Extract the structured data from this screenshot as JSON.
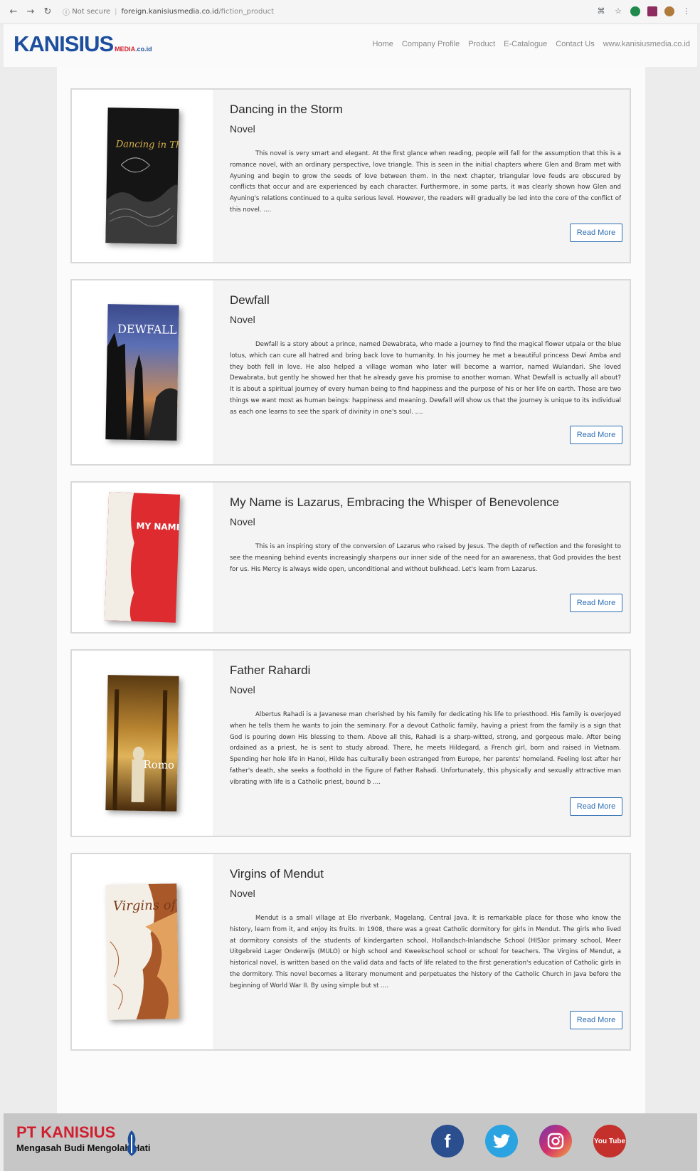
{
  "browser": {
    "security": "Not secure",
    "domain": "foreign.kanisiusmedia.co.id",
    "path": "/fiction_product"
  },
  "header": {
    "logo_main": "KANISIUS",
    "logo_sub": "MEDIA",
    "logo_domain": ".co.id",
    "nav": [
      "Home",
      "Company Profile",
      "Product",
      "E-Catalogue",
      "Contact Us",
      "www.kanisiusmedia.co.id"
    ]
  },
  "books": [
    {
      "title": "Dancing in the Storm",
      "genre": "Novel",
      "description": "This novel is very smart and elegant. At the first glance when reading, people will fall for the assumption that this is a romance novel, with an ordinary perspective, love triangle. This is seen in the initial chapters where Glen and Bram met with Ayuning and begin to grow the seeds of love between them. In the next chapter, triangular love feuds are obscured by conflicts that occur and are experienced by each character. Furthermore, in some parts, it was clearly shown how Glen and Ayuning's relations continued to a quite serious level. However, the readers will gradually be led into the core of the conflict of this novel. ....",
      "read_more": "Read More",
      "cover_text": "Dancing in The Storm"
    },
    {
      "title": "Dewfall",
      "genre": "Novel",
      "description": "Dewfall is a story about a prince, named Dewabrata, who made a journey to find the magical flower utpala or the blue lotus, which can cure all hatred and bring back love to humanity. In his journey he met a beautiful princess Dewi Amba and they both fell in love. He also helped a village woman who later will become a warrior, named Wulandari. She loved Dewabrata, but gently he showed her that he already gave his promise to another woman. What Dewfall is actually all about? It is about a spiritual journey of every human being to find happiness and the purpose of his or her life on earth. Those are two things we want most as human beings: happiness and meaning. Dewfall will show us that the journey is unique to its individual as each one learns to see the spark of divinity in one's soul. ....",
      "read_more": "Read More",
      "cover_text": "DEWFALL"
    },
    {
      "title": "My Name is Lazarus, Embracing the Whisper of Benevolence",
      "genre": "Novel",
      "description": "This is an inspiring story of the conversion of Lazarus who raised by Jesus. The depth of reflection and the foresight to see the meaning behind events increasingly sharpens our inner side of the need for an awareness, that God provides the best for us. His Mercy is always wide open, unconditional and without bulkhead. Let's learn from Lazarus.",
      "read_more": "Read More",
      "cover_text": "MY NAME IS LAZARUS"
    },
    {
      "title": "Father Rahardi",
      "genre": "Novel",
      "description": "Albertus Rahadi is a Javanese man cherished by his family for dedicating his life to priesthood. His family is overjoyed when he tells them he wants to join the seminary. For a devout Catholic family, having a priest from the family is a sign that God is pouring down His blessing to them. Above all this, Rahadi is a sharp-witted, strong, and gorgeous male. After being ordained as a priest, he is sent to study abroad. There, he meets Hildegard, a French girl, born and raised in Vietnam. Spending her hole life in Hanoi, Hilde has culturally been estranged from Europe, her parents' homeland. Feeling lost after her father's death, she seeks a foothold in the figure of Father Rahadi. Unfortunately, this physically and sexually attractive man vibrating with life is a Catholic priest, bound b ....",
      "read_more": "Read More",
      "cover_text": "Romo Rahadi"
    },
    {
      "title": "Virgins of Mendut",
      "genre": "Novel",
      "description": "Mendut is a small village at Elo riverbank, Magelang, Central Java. It is remarkable place for those who know the history, learn from it, and enjoy its fruits. In 1908, there was a great Catholic dormitory for girls in Mendut. The girls who lived at dormitory consists of the students of kindergarten school, Hollandsch-Inlandsche School (HIS)or primary school, Meer Uitgebreid Lager Onderwijs (MULO) or high school and Kweekschool school or school for teachers. The Virgins of Mendut, a historical novel, is written based on the valid data and facts of life related to the first generation's education of Catholic girls in the dormitory. This novel becomes a literary monument and perpetuates the history of the Catholic Church in Java before the beginning of World War II. By using simple but st ....",
      "read_more": "Read More",
      "cover_text": "Virgins of Mendut"
    }
  ],
  "footer": {
    "brand": "PT KANISIUS",
    "tagline": "Mengasah Budi Mengolah Hati",
    "social": [
      "facebook-icon",
      "twitter-icon",
      "instagram-icon",
      "youtube-icon"
    ],
    "youtube_text": "You Tube"
  }
}
